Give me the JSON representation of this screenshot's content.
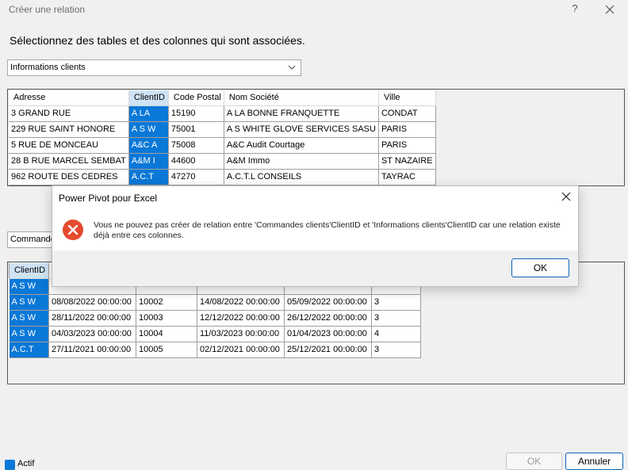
{
  "window": {
    "title": "Créer une relation",
    "help_symbol": "?"
  },
  "instruction": "Sélectionnez des tables et des colonnes qui sont associées.",
  "table1": {
    "selected": "Informations clients",
    "columns": [
      "Adresse",
      "ClientID",
      "Code Postal",
      "Nom Société",
      "Ville"
    ],
    "rows": [
      [
        "3 GRAND RUE",
        "A LA",
        "15190",
        "A LA BONNE FRANQUETTE",
        "CONDAT"
      ],
      [
        "229 RUE SAINT HONORE",
        "A S W",
        "75001",
        "A S WHITE GLOVE SERVICES SASU",
        "PARIS"
      ],
      [
        "5 RUE DE MONCEAU",
        "A&C A",
        "75008",
        "A&C Audit Courtage",
        "PARIS"
      ],
      [
        "28 B RUE MARCEL SEMBAT",
        "A&M I",
        "44600",
        "A&M Immo",
        "ST NAZAIRE"
      ],
      [
        "962 ROUTE DES CEDRES",
        "A.C.T",
        "47270",
        "A.C.T.L CONSEILS",
        "TAYRAC"
      ]
    ]
  },
  "table2": {
    "selected": "Commandes",
    "columns": [
      "ClientID"
    ],
    "rows": [
      [
        "A S W",
        "08/08/2022 00:00:00",
        "10002",
        "14/08/2022 00:00:00",
        "05/09/2022 00:00:00",
        "3"
      ],
      [
        "A S W",
        "28/11/2022 00:00:00",
        "10003",
        "12/12/2022 00:00:00",
        "26/12/2022 00:00:00",
        "3"
      ],
      [
        "A S W",
        "04/03/2023 00:00:00",
        "10004",
        "11/03/2023 00:00:00",
        "01/04/2023 00:00:00",
        "4"
      ],
      [
        "A.C.T",
        "27/11/2021 00:00:00",
        "10005",
        "02/12/2021 00:00:00",
        "25/12/2021 00:00:00",
        "3"
      ]
    ],
    "partial_row": [
      "A S W"
    ]
  },
  "footer": {
    "checkbox_label": "Actif",
    "ok_label": "OK",
    "cancel_label": "Annuler"
  },
  "dialog": {
    "title": "Power Pivot pour Excel",
    "message": "Vous ne pouvez pas créer de relation entre 'Commandes clients'ClientID et 'Informations clients'ClientID car une relation existe déjà entre ces colonnes.",
    "ok_label": "OK"
  },
  "colors": {
    "selection": "#0a78d7",
    "header_selection": "#cfe3f5",
    "error_red": "#e64a2e",
    "primary_border": "#0a64bf"
  }
}
